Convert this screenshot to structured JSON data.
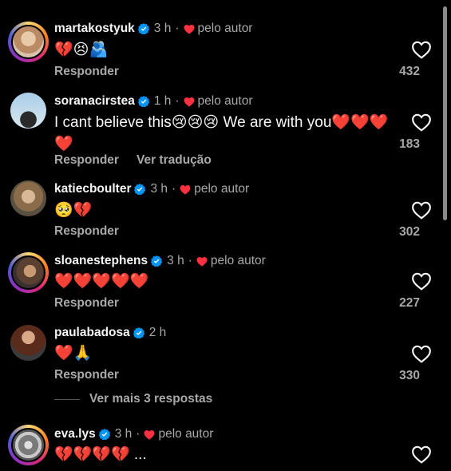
{
  "comments": [
    {
      "username": "martakostyuk",
      "time": "3 h",
      "by_author": "pelo autor",
      "text": "💔😣🫂",
      "reply_label": "Responder",
      "likes": "432",
      "avatar_color": "#c9a27e"
    },
    {
      "username": "soranacirstea",
      "time": "1 h",
      "by_author": "pelo autor",
      "text": "I cant believe this😢😢😢 We are with you❤️❤️❤️❤️",
      "reply_label": "Responder",
      "translate_label": "Ver tradução",
      "likes": "183",
      "avatar_color": "#8fb6d8"
    },
    {
      "username": "katiecboulter",
      "time": "3 h",
      "by_author": "pelo autor",
      "text": "🥺💔",
      "reply_label": "Responder",
      "likes": "302",
      "avatar_color": "#8a7a5e"
    },
    {
      "username": "sloanestephens",
      "time": "3 h",
      "by_author": "pelo autor",
      "text": "❤️❤️❤️❤️❤️",
      "reply_label": "Responder",
      "likes": "227",
      "avatar_color": "#6b5a4a"
    },
    {
      "username": "paulabadosa",
      "time": "2 h",
      "text": "❤️🙏",
      "reply_label": "Responder",
      "likes": "330",
      "avatar_color": "#7a4a3a"
    },
    {
      "username": "eva.lys",
      "time": "3 h",
      "by_author": "pelo autor",
      "text": "💔💔💔💔 ...",
      "avatar_color": "#9a9a9a"
    }
  ],
  "more_replies": "Ver mais 3 respostas",
  "dot": "·",
  "icons": {
    "verified": "verified-badge-icon",
    "heart_small": "heart-small-icon",
    "like": "heart-outline-icon"
  },
  "colors": {
    "background": "#000000",
    "verified_blue": "#0095f6",
    "heart_red": "#ff3040",
    "muted": "#a8a8a8"
  }
}
